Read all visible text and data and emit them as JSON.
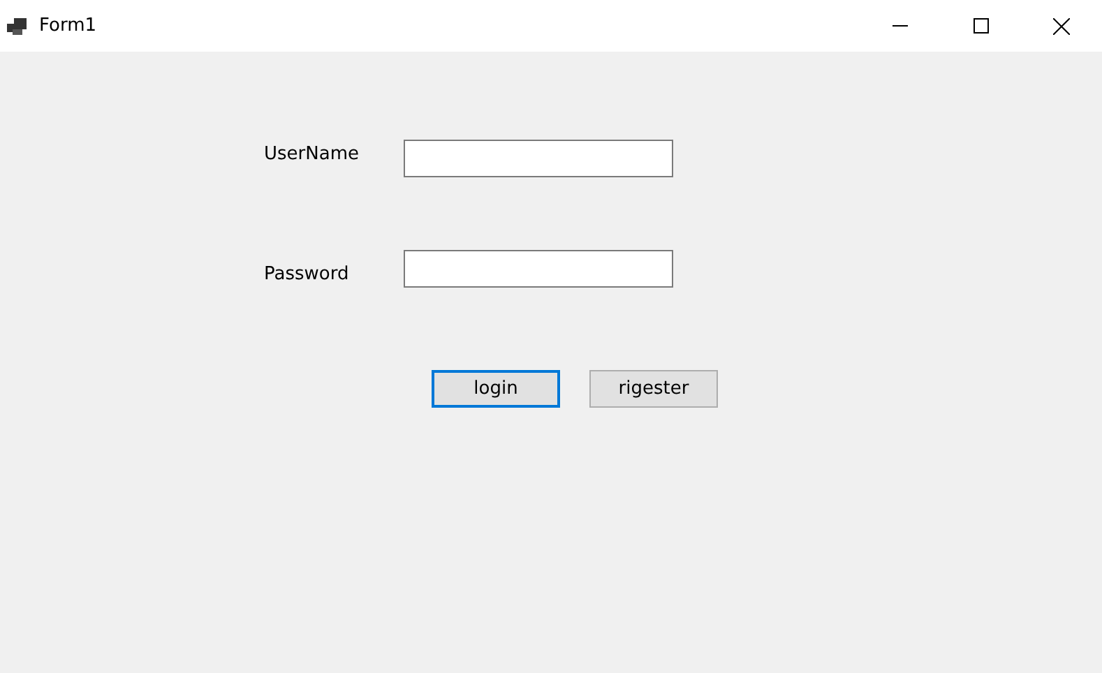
{
  "window": {
    "title": "Form1"
  },
  "fields": [
    {
      "label": "UserName"
    },
    {
      "label": "Password"
    }
  ],
  "buttons": [
    {
      "label": "login",
      "focused": true
    },
    {
      "label": "rigester",
      "focused": false
    }
  ]
}
